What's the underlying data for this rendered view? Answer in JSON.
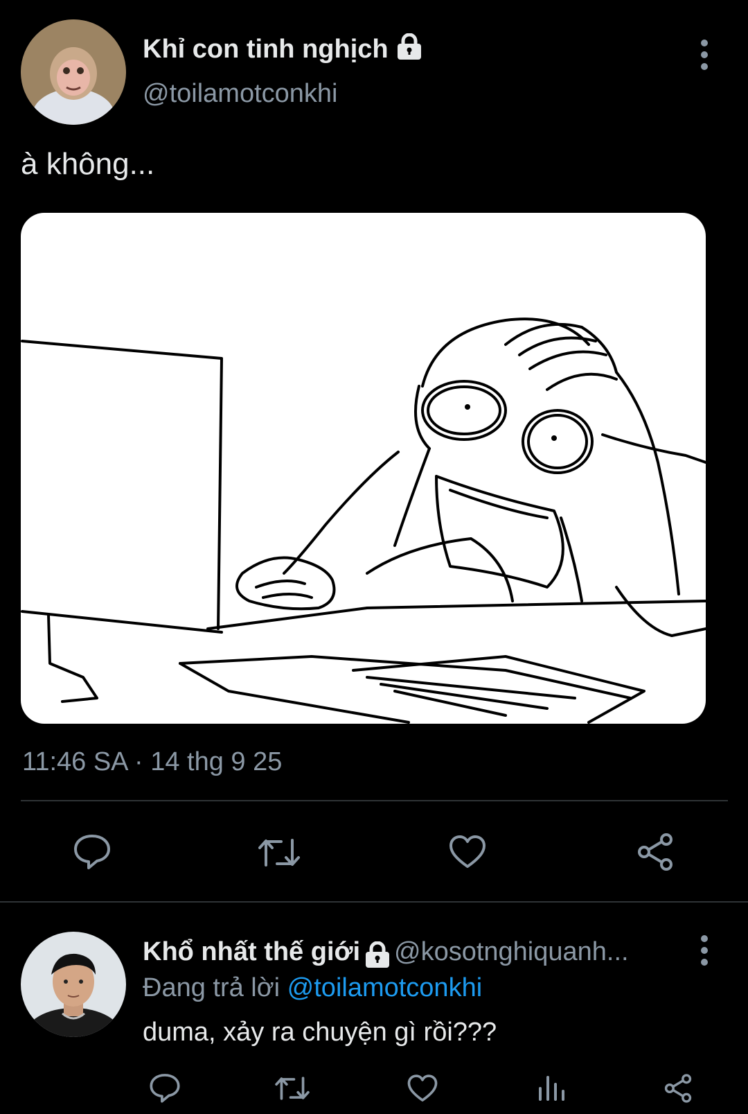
{
  "tweet": {
    "author_name": "Khỉ con tinh nghịch",
    "author_handle": "@toilamotconkhi",
    "text": "à không...",
    "time": "11:46 SA",
    "separator": "·",
    "date": "14 thg 9 25",
    "icons": [
      "lock-icon",
      "more-icon",
      "reply-icon",
      "retweet-icon",
      "like-icon",
      "share-icon"
    ]
  },
  "reply": {
    "author_name": "Khổ nhất thế giới",
    "author_handle": "@kosotnghiquanh...",
    "replying_prefix": "Đang trả lời",
    "replying_to": "@toilamotconkhi",
    "text": "duma, xảy ra chuyện gì rồi???",
    "icons": [
      "lock-icon",
      "more-icon",
      "reply-icon",
      "retweet-icon",
      "like-icon",
      "views-icon",
      "share-icon"
    ]
  },
  "colors": {
    "background": "#000000",
    "text": "#e7e9ea",
    "secondary": "#8b98a5",
    "link": "#1d9bf0",
    "divider": "#2f3336"
  }
}
